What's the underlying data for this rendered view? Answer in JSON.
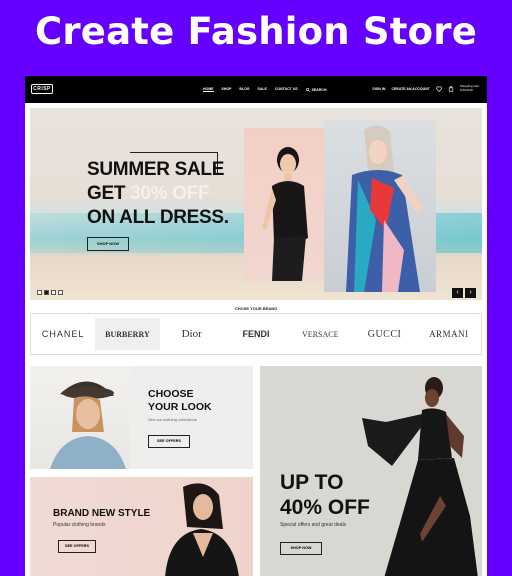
{
  "headline": "Create Fashion Store",
  "nav": {
    "logo": "CRISP",
    "menu": [
      "HOME",
      "SHOP",
      "BLOG",
      "SALE",
      "CONTACT US"
    ],
    "search_label": "SEARCH",
    "sign_in": "SIGN IN",
    "create_account": "CREATE AN ACCOUNT",
    "cart_line1": "Shopping Cart",
    "cart_line2": "0,00 EUR"
  },
  "hero": {
    "line1": "SUMMER SALE",
    "line2_prefix": "GET ",
    "line2_highlight": "30% OFF",
    "line3": "ON ALL DRESS.",
    "button": "SHOP NOW",
    "slide_count": 4,
    "active_slide": 2,
    "prev_arrow": "‹",
    "next_arrow": "›"
  },
  "brands": {
    "caption": "CHOSE YOUR BRAND",
    "items": [
      "CHANEL",
      "BURBERRY",
      "Dior",
      "FENDI",
      "VERSACE",
      "GUCCI",
      "ARMANI"
    ],
    "selected": "BURBERRY"
  },
  "promo1": {
    "title_line1": "CHOOSE",
    "title_line2": "YOUR LOOK",
    "subtitle": "See our clothing collections",
    "button": "SEE OFFERS"
  },
  "promo2": {
    "title": "BRAND NEW STYLE",
    "subtitle": "Popular clothing brands",
    "button": "SEE OFFERS"
  },
  "promo3": {
    "title_line1": "UP TO",
    "title_line2": "40% OFF",
    "subtitle": "Special offers and great deals",
    "button": "SHOP NOW"
  },
  "colors": {
    "background": "#6500ff",
    "nav": "#000000",
    "text": "#111111"
  }
}
